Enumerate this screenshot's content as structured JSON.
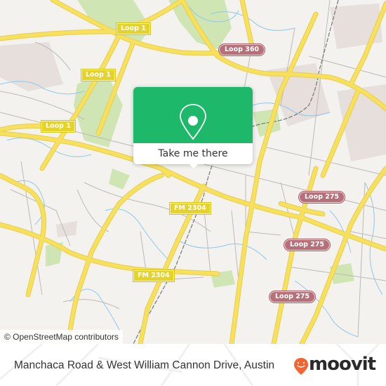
{
  "map": {
    "attribution": "© OpenStreetMap contributors",
    "shields": [
      {
        "label": "Loop 1",
        "style": "yellow"
      },
      {
        "label": "Loop 1",
        "style": "yellow"
      },
      {
        "label": "Loop 1",
        "style": "yellow"
      },
      {
        "label": "Loop 360",
        "style": "loop"
      },
      {
        "label": "FM 2304",
        "style": "yellow"
      },
      {
        "label": "FM 2304",
        "style": "yellow"
      },
      {
        "label": "Loop 275",
        "style": "loop"
      },
      {
        "label": "Loop 275",
        "style": "loop"
      },
      {
        "label": "Loop 275",
        "style": "loop"
      }
    ],
    "colors": {
      "background": "#f3f2ef",
      "major_road": "#f7e15c",
      "minor_road": "#bdbab5",
      "water": "#8ec8e8",
      "park": "#cfe6b4",
      "railway": "#777777"
    }
  },
  "popup": {
    "icon": "location-pin-icon",
    "button_label": "Take me there",
    "accent_color": "#1db86a"
  },
  "footer": {
    "place_title": "Manchaca Road & West William Cannon Drive, Austin",
    "brand": "moovit",
    "brand_color": "#f26531"
  }
}
